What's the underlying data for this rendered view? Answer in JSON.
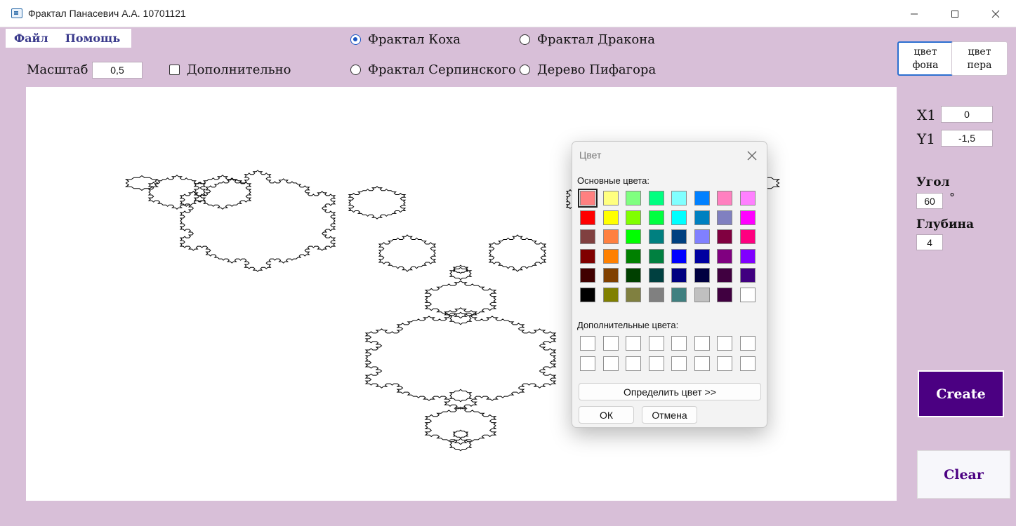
{
  "window": {
    "title": "Фрактал Панасевич А.А. 10701121"
  },
  "menu": {
    "items": [
      "Файл",
      "Помощь"
    ]
  },
  "controls": {
    "scale_label": "Масштаб",
    "scale_value": "0,5",
    "extra_label": "Дополнительно",
    "extra_checked": false,
    "fractal_options": [
      {
        "label": "Фрактал Коха",
        "selected": true
      },
      {
        "label": "Фрактал Дракона",
        "selected": false
      },
      {
        "label": "Фрактал Серпинского",
        "selected": false
      },
      {
        "label": "Дерево Пифагора",
        "selected": false
      }
    ],
    "bg_color_button": [
      "цвет",
      "фона"
    ],
    "pen_color_button": [
      "цвет",
      "пера"
    ],
    "x1_label": "X1",
    "x1_value": "0",
    "y1_label": "Y1",
    "y1_value": "-1,5",
    "angle_label": "Угол",
    "angle_value": "60",
    "angle_unit": "°",
    "depth_label": "Глубина",
    "depth_value": "4",
    "create_label": "Create",
    "clear_label": "Clear"
  },
  "canvas": {
    "background": "#ffffff",
    "pen_color": "#000000",
    "fractal": "koch_snowflake_tree"
  },
  "color_dialog": {
    "title": "Цвет",
    "basic_colors_label": "Основные цвета:",
    "basic_colors": [
      "#ff8080",
      "#ffff80",
      "#80ff80",
      "#00ff80",
      "#80ffff",
      "#0080ff",
      "#ff80c0",
      "#ff80ff",
      "#ff0000",
      "#ffff00",
      "#80ff00",
      "#00ff40",
      "#00ffff",
      "#0080c0",
      "#8080c0",
      "#ff00ff",
      "#804040",
      "#ff8040",
      "#00ff00",
      "#008080",
      "#004080",
      "#8080ff",
      "#800040",
      "#ff0080",
      "#800000",
      "#ff8000",
      "#008000",
      "#008040",
      "#0000ff",
      "#0000a0",
      "#800080",
      "#8000ff",
      "#400000",
      "#804000",
      "#004000",
      "#004040",
      "#000080",
      "#000040",
      "#400040",
      "#400080",
      "#000000",
      "#808000",
      "#808040",
      "#808080",
      "#408080",
      "#c0c0c0",
      "#400040",
      "#ffffff"
    ],
    "selected_index": 0,
    "custom_colors_label": "Дополнительные цвета:",
    "custom_colors_count": 16,
    "define_button": "Определить цвет >>",
    "ok_button": "ОК",
    "cancel_button": "Отмена"
  },
  "colors": {
    "form_background": "#d8bfd8",
    "create_button": "#4b0082",
    "clear_text": "#4b0082"
  }
}
